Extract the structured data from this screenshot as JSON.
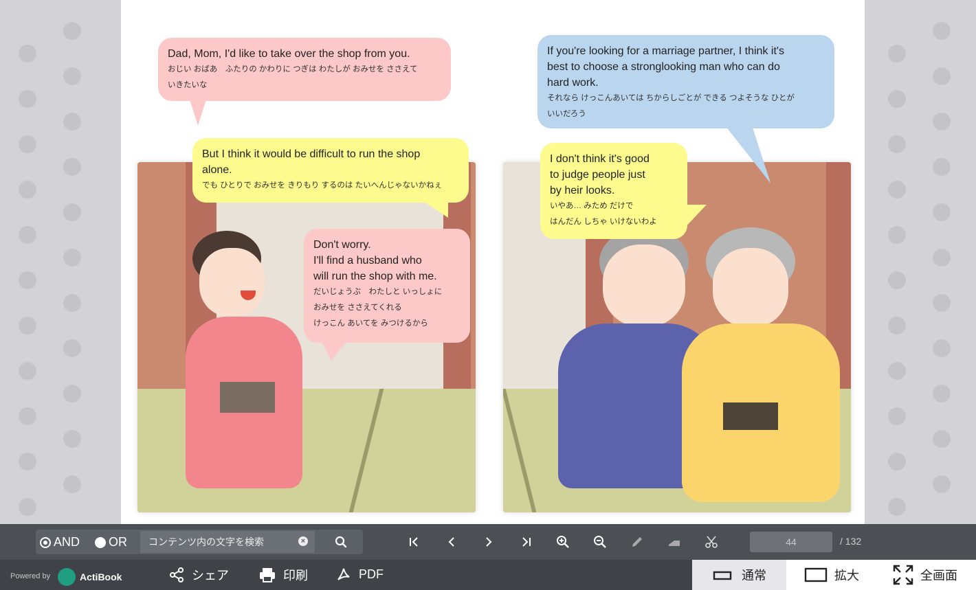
{
  "book": {
    "left_page": {
      "bubble1": {
        "en": "Dad, Mom, I'd like to take over the shop from you.",
        "jp1": "おじい おばあ　ふたりの かわりに つぎは わたしが おみせを ささえて",
        "jp2": "いきたいな"
      },
      "bubble2": {
        "en1": "But I think it would be difficult to run the shop",
        "en2": "alone.",
        "jp": "でも ひとりで おみせを きりもり するのは たいへんじゃないかねぇ"
      },
      "bubble3": {
        "en1": "Don't worry.",
        "en2": "I'll find a husband who",
        "en3": "will run the shop with me.",
        "jp1": "だいじょうぶ　わたしと いっしょに",
        "jp2": "おみせを ささえてくれる",
        "jp3": "けっこん あいてを みつけるから"
      }
    },
    "right_page": {
      "bubble1": {
        "en1": "If you're looking for a marriage partner, I think it's",
        "en2": "best to choose a stronglooking man who can do",
        "en3": "hard work.",
        "jp1": "それなら けっこんあいては ちからしごとが できる つよそうな ひとが",
        "jp2": "いいだろう"
      },
      "bubble2": {
        "en1": "I don't think it's good",
        "en2": "to judge people just",
        "en3": "by heir looks.",
        "jp1": "いやあ… みため だけで",
        "jp2": "はんだん しちゃ いけないわよ"
      }
    }
  },
  "toolbar": {
    "and_label": "AND",
    "or_label": "OR",
    "search_placeholder": "コンテンツ内の文字を検索",
    "current_page": "44",
    "total_pages": "/ 132"
  },
  "bottombar": {
    "powered_by": "Powered by",
    "brand": "ActiBook",
    "share": "シェア",
    "print": "印刷",
    "pdf": "PDF",
    "view_normal": "通常",
    "view_zoom": "拡大",
    "view_fullscreen": "全画面"
  },
  "colors": {
    "toolbar_bg": "#4c5055",
    "bottombar_bg": "#3f4247",
    "bubble_pink": "#fcc8c8",
    "bubble_yellow": "#fdfb8d",
    "bubble_blue": "#bad6ee"
  }
}
